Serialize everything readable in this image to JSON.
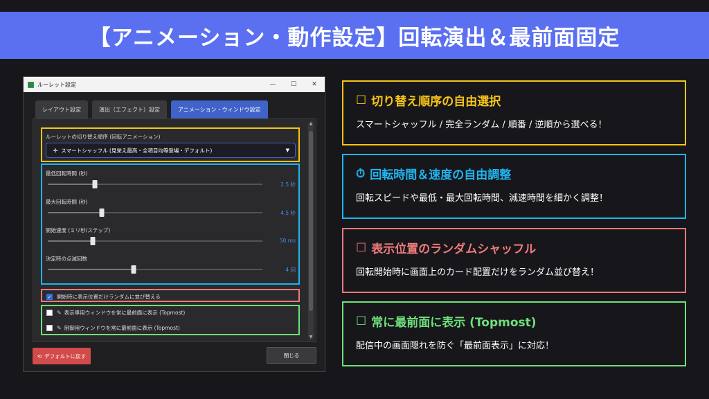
{
  "banner": {
    "title": "【アニメーション・動作設定】回転演出＆最前面固定"
  },
  "window": {
    "title": "ルーレット設定",
    "controls": {
      "minimize": "—",
      "maximize": "☐",
      "close": "✕"
    },
    "tabs": [
      {
        "label": "レイアウト設定",
        "active": false
      },
      {
        "label": "演出（エフェクト）設定",
        "active": false
      },
      {
        "label": "アニメーション・ウィンドウ設定",
        "active": true
      }
    ],
    "order": {
      "label": "ルーレットの切り替え順序 (回転アニメーション)",
      "selected": "スマートシャッフル (見栄え最高・全項目均等登場・デフォルト)",
      "icon": "shuffle-icon"
    },
    "sliders": [
      {
        "label": "最低回転時間 (秒)",
        "value_text": "2.5 秒",
        "level": 0.22
      },
      {
        "label": "最大回転時間 (秒)",
        "value_text": "4.5 秒",
        "level": 0.25
      },
      {
        "label": "開始速度 (ミリ秒/ステップ)",
        "value_text": "50 ms",
        "level": 0.21
      },
      {
        "label": "決定時の点滅回数",
        "value_text": "4 回",
        "level": 0.4
      }
    ],
    "checkboxes": [
      {
        "label": "開始時に表示位置だけランダムに並び替える",
        "checked": true
      },
      {
        "label": "表示専用ウィンドウを常に最前面に表示 (Topmost)",
        "checked": false
      },
      {
        "label": "制御用ウィンドウを常に最前面に表示 (Topmost)",
        "checked": false
      }
    ],
    "buttons": {
      "reset": "デフォルトに戻す",
      "close": "閉じる"
    }
  },
  "cards": [
    {
      "title": "切り替え順序の自由選択",
      "icon": "checkbox-icon",
      "desc": "スマートシャッフル / 完全ランダム / 順番 / 逆順から選べる！",
      "color": "#f5c518"
    },
    {
      "title": "回転時間＆速度の自由調整",
      "icon": "stopwatch-icon",
      "desc": "回転スピードや最低・最大回転時間、減速時間を細かく調整！",
      "color": "#1fb4ee"
    },
    {
      "title": "表示位置のランダムシャッフル",
      "icon": "checkbox-icon",
      "desc": "回転開始時に画面上のカード配置だけをランダム並び替え！",
      "color": "#f07a7a"
    },
    {
      "title": "常に最前面に表示 (Topmost)",
      "icon": "checkbox-icon",
      "desc": "配信中の画面隠れを防ぐ「最前面表示」に対応！",
      "color": "#6ee07a"
    }
  ]
}
